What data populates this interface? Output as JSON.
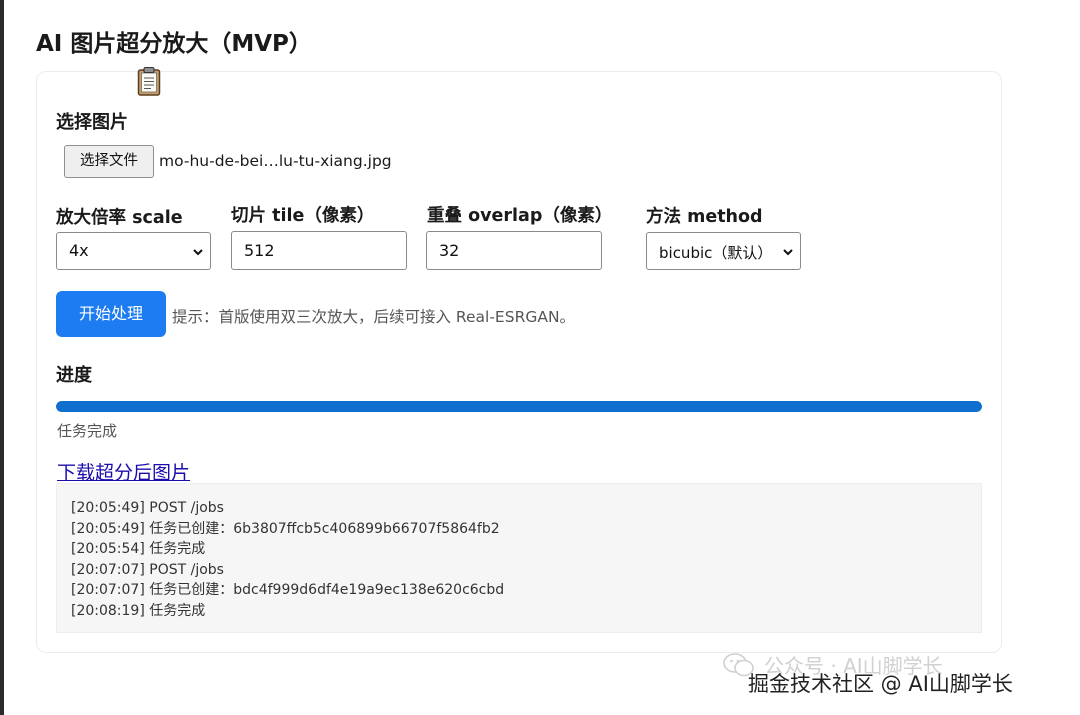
{
  "page": {
    "title": "AI 图片超分放大（MVP）"
  },
  "upload": {
    "label": "选择图片",
    "button_label": "选择文件",
    "file_name": "mo-hu-de-bei…lu-tu-xiang.jpg"
  },
  "params": {
    "scale": {
      "label": "放大倍率 scale",
      "value": "4x"
    },
    "tile": {
      "label": "切片 tile（像素）",
      "value": "512"
    },
    "overlap": {
      "label": "重叠 overlap（像素）",
      "value": "32"
    },
    "method": {
      "label": "方法 method",
      "value": "bicubic（默认）"
    }
  },
  "actions": {
    "start_label": "开始处理",
    "hint": "提示：首版使用双三次放大，后续可接入 Real-ESRGAN。"
  },
  "progress": {
    "label": "进度",
    "percent": 100,
    "status": "任务完成",
    "color": "#0f6fcf"
  },
  "download": {
    "label": "下载超分后图片"
  },
  "log": {
    "lines": [
      "[20:05:49] POST /jobs",
      "[20:05:49] 任务已创建：6b3807ffcb5c406899b66707f5864fb2",
      "[20:05:54] 任务完成",
      "[20:07:07] POST /jobs",
      "[20:07:07] 任务已创建：bdc4f999d6df4e19a9ec138e620c6cbd",
      "[20:08:19] 任务完成"
    ]
  },
  "watermark": {
    "line1": "公众号 · AI山脚学长",
    "line2": "掘金技术社区 @ AI山脚学长"
  },
  "colors": {
    "primary": "#1e7cf2",
    "link": "#1a0dab"
  }
}
